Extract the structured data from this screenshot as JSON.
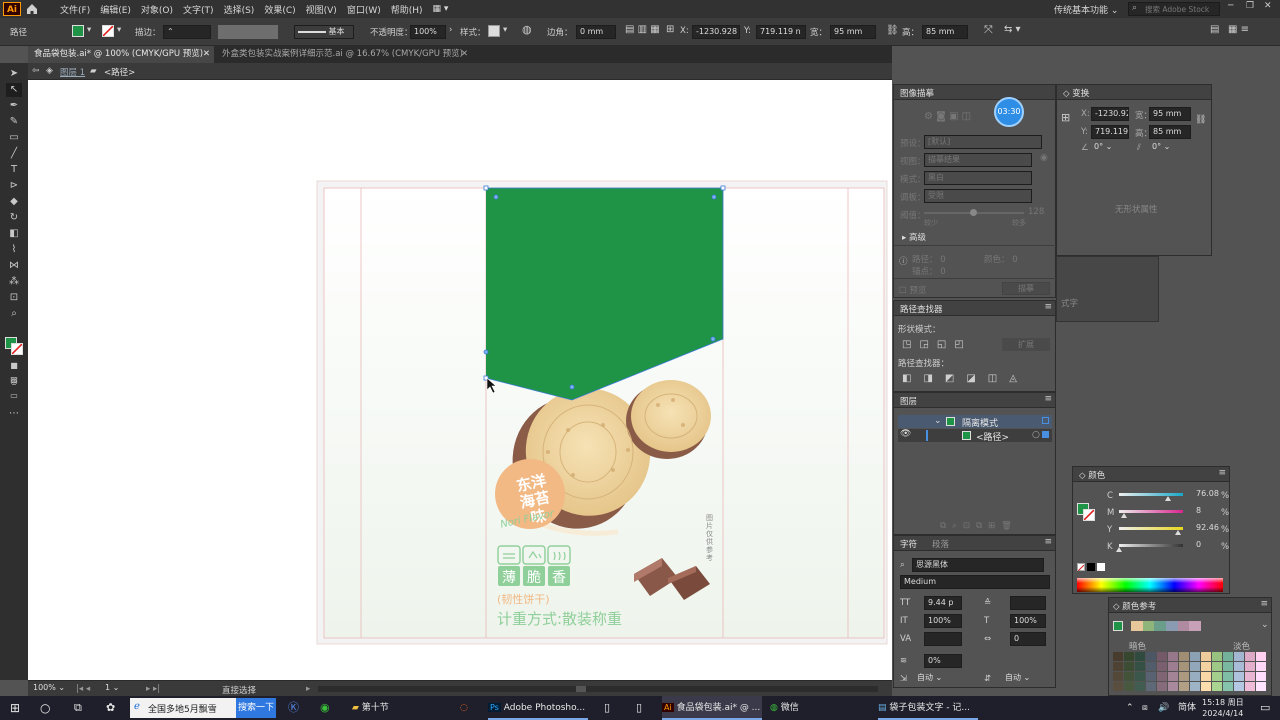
{
  "app": {
    "logo": "Ai",
    "home_icon": "home-icon"
  },
  "menu": [
    "文件(F)",
    "编辑(E)",
    "对象(O)",
    "文字(T)",
    "选择(S)",
    "效果(C)",
    "视图(V)",
    "窗口(W)",
    "帮助(H)"
  ],
  "workspace": {
    "label": "传统基本功能",
    "search_placeholder": "搜索 Adobe Stock"
  },
  "control": {
    "object_type": "路径",
    "stroke_label": "描边：",
    "stroke_style": "基本",
    "opacity_label": "不透明度：",
    "opacity_value": "100%",
    "style_label": "样式：",
    "corner_label": "边角：",
    "corner_value": "0 mm",
    "x_label": "X:",
    "x_value": "-1230.928",
    "y_label": "Y:",
    "y_value": "719.119 n",
    "w_label": "宽：",
    "w_value": "95 mm",
    "h_label": "高：",
    "h_value": "85 mm",
    "fill_color": "#1f9447"
  },
  "tabs": [
    {
      "label": "食品袋包装.ai* @ 100% (CMYK/GPU 预览)",
      "active": true
    },
    {
      "label": "外盒类包装实战案例详细示范.ai @ 16.67% (CMYK/GPU 预览)",
      "active": false
    }
  ],
  "breadcrumb": {
    "layer": "图层 1",
    "path": "<路径>"
  },
  "artwork": {
    "bag_color": "#1f9447",
    "flavor_line1": "东洋",
    "flavor_line2": "海苔味",
    "flavor_en": "Nori Flavor",
    "badges": [
      "薄",
      "脆",
      "香"
    ],
    "subtitle": "(韧性饼干)",
    "weight_text": "计重方式:散装称重",
    "side_note": "图片仅供参考"
  },
  "image_trace": {
    "title": "图像描摹",
    "timer": "03:30",
    "preset_label": "预设：",
    "preset_value": "[默认]",
    "view_label": "视图：",
    "view_value": "描摹结果",
    "mode_label": "模式：",
    "mode_value": "黑白",
    "palette_label": "调板：",
    "palette_value": "受限",
    "threshold_label": "阈值：",
    "threshold_value": "128",
    "less": "较少",
    "more": "较多",
    "advanced": "高级",
    "paths_label": "路径：",
    "paths_value": "0",
    "colors_label": "颜色：",
    "colors_value": "0",
    "anchors_label": "锚点：",
    "anchors_value": "0",
    "preview": "预览",
    "trace_button": "描摹"
  },
  "transform": {
    "title": "变换",
    "x_label": "X:",
    "x_value": "-1230.92",
    "y_label": "Y:",
    "y_value": "719.119",
    "w_label": "宽：",
    "w_value": "95 mm",
    "h_label": "高：",
    "h_value": "85 mm",
    "angle_value": "0°",
    "shear_value": "0°",
    "no_shape": "无形状属性",
    "fragment": "式字"
  },
  "pathfinder": {
    "title": "路径查找器",
    "shape_modes": "形状模式：",
    "expand": "扩展",
    "pathfinders": "路径查找器："
  },
  "layers": {
    "title": "图层",
    "rows": [
      {
        "label": "隔离模式"
      },
      {
        "label": "<路径>"
      }
    ]
  },
  "character": {
    "tab1": "字符",
    "tab2": "段落",
    "font": "思源黑体",
    "weight": "Medium",
    "size": "9.44 p",
    "scale_v": "100%",
    "scale_h": "100%",
    "tracking": "0",
    "baseline": "0%",
    "auto1": "自动",
    "auto2": "自动"
  },
  "color": {
    "title": "颜色",
    "channels": [
      {
        "name": "C",
        "value": "76.08",
        "pct": 0.76,
        "color": "#1ba8c9"
      },
      {
        "name": "M",
        "value": "8",
        "pct": 0.08,
        "color": "#d8258f"
      },
      {
        "name": "Y",
        "value": "92.46",
        "pct": 0.92,
        "color": "#e8d620"
      },
      {
        "name": "K",
        "value": "0",
        "pct": 0.0,
        "color": "#333333"
      }
    ],
    "unit": "%"
  },
  "color_guide": {
    "title": "颜色参考",
    "dark": "暗色",
    "light": "淡色"
  },
  "status": {
    "zoom": "100%",
    "page": "1",
    "tool": "直接选择"
  },
  "taskbar": {
    "search_text": "全国多地5月飘雪",
    "search_button": "搜索一下",
    "folder": "第十节",
    "photoshop": "Adobe Photosho...",
    "illustrator": "食品袋包装.ai* @ ...",
    "wechat": "微信",
    "notepad": "袋子包装文字 - 记...",
    "ime": "简体",
    "time": "15:18 周日",
    "date": "2024/4/14"
  }
}
